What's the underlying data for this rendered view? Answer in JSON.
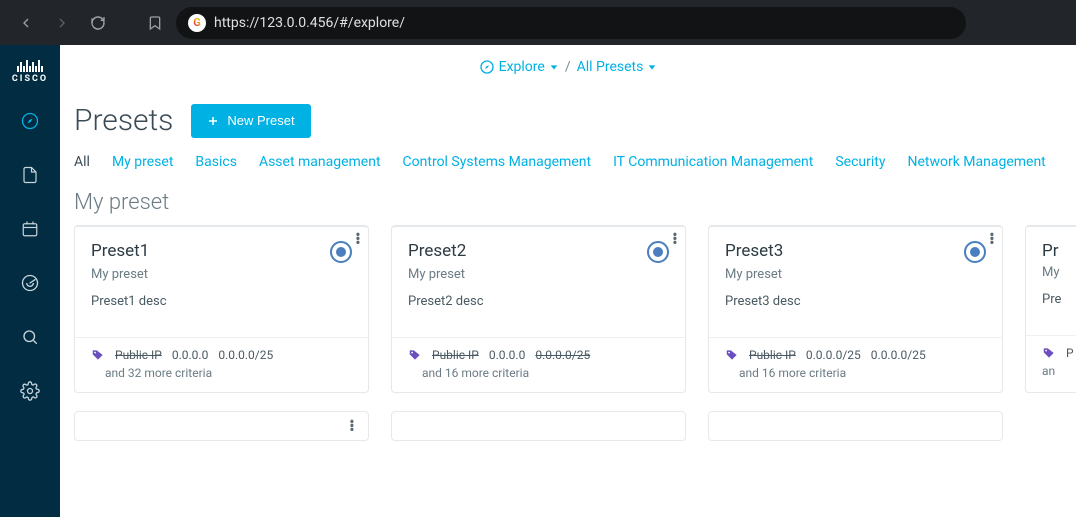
{
  "browser": {
    "url": "https://123.0.0.456/#/explore/"
  },
  "brand": "CISCO",
  "breadcrumb": {
    "explore": "Explore",
    "all": "All Presets"
  },
  "page": {
    "title": "Presets",
    "new_btn": "New Preset"
  },
  "tabs": {
    "all": "All",
    "my": "My preset",
    "basics": "Basics",
    "asset": "Asset management",
    "control": "Control Systems Management",
    "itcomm": "IT Communication Management",
    "security": "Security",
    "network": "Network Management"
  },
  "section": {
    "title": "My preset"
  },
  "cards": [
    {
      "title": "Preset1",
      "sub": "My preset",
      "desc": "Preset1 desc",
      "chip_label": "Public IP",
      "chip_label_strike": true,
      "ip1": "0.0.0.0",
      "ip1_strike": false,
      "ip2": "0.0.0.0/25",
      "ip2_strike": false,
      "more": "and 32 more criteria"
    },
    {
      "title": "Preset2",
      "sub": "My preset",
      "desc": "Preset2 desc",
      "chip_label": "Public IP",
      "chip_label_strike": true,
      "ip1": "0.0.0.0",
      "ip1_strike": false,
      "ip2": "0.0.0.0/25",
      "ip2_strike": true,
      "more": "and 16 more criteria"
    },
    {
      "title": "Preset3",
      "sub": "My preset",
      "desc": "Preset3 desc",
      "chip_label": "Public IP",
      "chip_label_strike": true,
      "ip1": "0.0.0.0/25",
      "ip1_strike": false,
      "ip2": "0.0.0.0/25",
      "ip2_strike": false,
      "more": "and 16 more criteria"
    },
    {
      "title": "Pr",
      "sub": "My",
      "desc": "Pre",
      "chip_label": "P",
      "chip_label_strike": false,
      "ip1": "",
      "ip1_strike": false,
      "ip2": "",
      "ip2_strike": false,
      "more": "an"
    }
  ]
}
